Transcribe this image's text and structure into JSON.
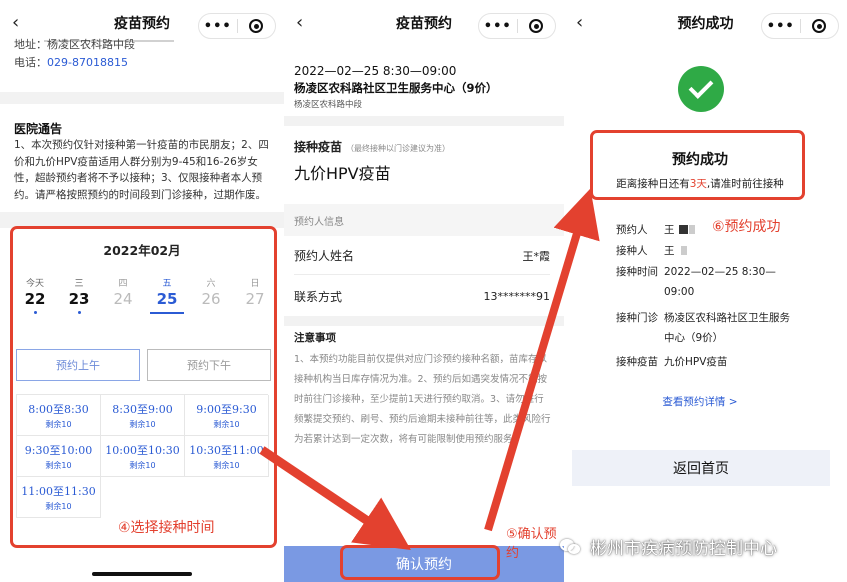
{
  "panel1": {
    "title": "疫苗预约",
    "back": "‹",
    "capsule_dots": "•••",
    "address": "地址：杨凌区农科路中段",
    "phone_label": "电话：",
    "phone": "029-87018815",
    "notice_title": "医院通告",
    "notice_body": "1、本次预约仅针对接种第一针疫苗的市民朋友；2、四价和九价HPV疫苗适用人群分别为9-45和16-26岁女性，超龄预约者将不予以接种；3、仅限接种者本人预约。请严格按照预约的时间段到门诊接种，过期作废。",
    "calendar_title": "2022年02月",
    "days": [
      {
        "weekday": "今天",
        "day": "22",
        "state": "active",
        "dot": true
      },
      {
        "weekday": "三",
        "day": "23",
        "state": "active",
        "dot": true
      },
      {
        "weekday": "四",
        "day": "24",
        "state": "past",
        "dot": false
      },
      {
        "weekday": "五",
        "day": "25",
        "state": "selected",
        "dot": false
      },
      {
        "weekday": "六",
        "day": "26",
        "state": "past",
        "dot": false
      },
      {
        "weekday": "日",
        "day": "27",
        "state": "past",
        "dot": false
      }
    ],
    "am_label": "预约上午",
    "pm_label": "预约下午",
    "slots": [
      {
        "time": "8:00至8:30",
        "remain": "剩余10"
      },
      {
        "time": "8:30至9:00",
        "remain": "剩余10"
      },
      {
        "time": "9:00至9:30",
        "remain": "剩余10"
      },
      {
        "time": "9:30至10:00",
        "remain": "剩余10"
      },
      {
        "time": "10:00至10:30",
        "remain": "剩余10"
      },
      {
        "time": "10:30至11:00",
        "remain": "剩余10"
      },
      {
        "time": "11:00至11:30",
        "remain": "剩余10"
      }
    ],
    "annotation": "④选择接种时间"
  },
  "panel2": {
    "title": "疫苗预约",
    "datetime": "2022—02—25 8:30—09:00",
    "center": "杨凌区农科路社区卫生服务中心（9价）",
    "center_addr": "杨凌区农科路中段",
    "vaccine_label": "接种疫苗",
    "vaccine_hint": "（最终接种以门诊建议为准）",
    "vaccine_name": "九价HPV疫苗",
    "section_header": "预约人信息",
    "name_label": "预约人姓名",
    "name_value": "王*霞",
    "contact_label": "联系方式",
    "contact_value": "13*******91",
    "notes_title": "注意事项",
    "notes_body": "1、本预约功能目前仅提供对应门诊预约接种名额，苗库存以接种机构当日库存情况为准。2、预约后如遇突发情况不能按时前往门诊接种，至少提前1天进行预约取消。3、请勿进行频繁提交预约、刷号、预约后逾期未接种前往等，此类风险行为若累计达到一定次数，将有可能限制使用预约服务。",
    "confirm_label": "确认预约",
    "annotation": "⑤确认预约"
  },
  "panel3": {
    "title": "预约成功",
    "success_title": "预约成功",
    "success_sub_pre": "距离接种日还有",
    "success_sub_days": "3天",
    "success_sub_post": ",请准时前往接种",
    "info": [
      {
        "key": "预约人",
        "value": "王"
      },
      {
        "key": "接种人",
        "value": "王"
      },
      {
        "key": "接种时间",
        "value": "2022—02—25 8:30—09:00"
      },
      {
        "key": "接种门诊",
        "value": "杨凌区农科路社区卫生服务中心（9价）"
      },
      {
        "key": "接种疫苗",
        "value": "九价HPV疫苗"
      }
    ],
    "detail_link": "查看预约详情 >",
    "home_label": "返回首页",
    "annotation": "⑥预约成功"
  },
  "watermark": "彬州市疾病预防控制中心",
  "colors": {
    "annotation_red": "#e3412f",
    "link_blue": "#2b5bd4",
    "confirm_blue": "#7a99e3",
    "success_green": "#2faa46"
  }
}
